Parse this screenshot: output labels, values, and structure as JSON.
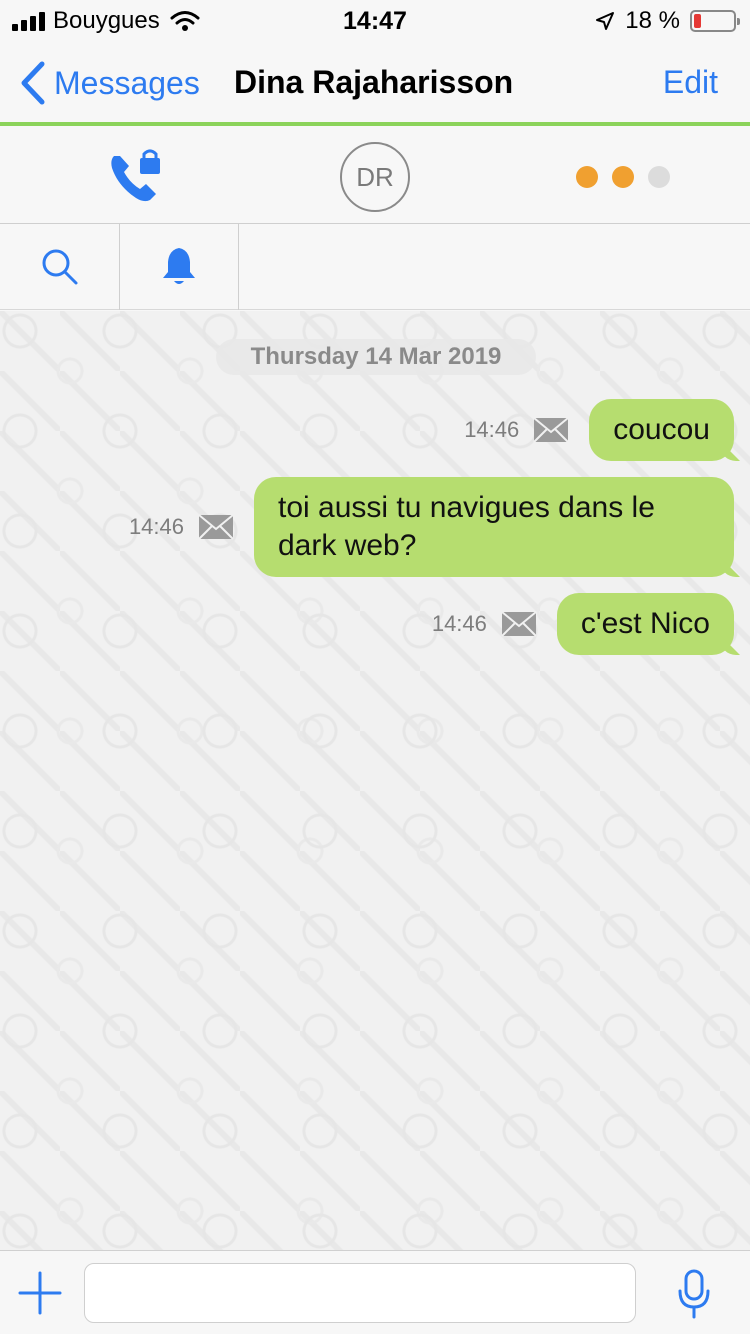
{
  "status_bar": {
    "carrier": "Bouygues",
    "time": "14:47",
    "battery_percent": "18 %",
    "battery_level": 0.18
  },
  "nav": {
    "back_label": "Messages",
    "title": "Dina Rajaharisson",
    "edit_label": "Edit"
  },
  "contact": {
    "avatar_initials": "DR",
    "status_dots": [
      "#f0a030",
      "#f0a030",
      "#dcdcdc"
    ]
  },
  "chat": {
    "date": "Thursday 14 Mar 2019",
    "messages": [
      {
        "text": "coucou",
        "time": "14:46",
        "status_icon": "envelope-icon"
      },
      {
        "text": "toi aussi tu navigues dans le dark web?",
        "time": "14:46",
        "status_icon": "envelope-icon"
      },
      {
        "text": "c'est Nico",
        "time": "14:46",
        "status_icon": "envelope-icon"
      }
    ]
  },
  "input": {
    "placeholder": ""
  },
  "colors": {
    "accent": "#2d7bf0",
    "bubble_out": "#b6dd6f",
    "nav_divider": "#8bd35a"
  }
}
